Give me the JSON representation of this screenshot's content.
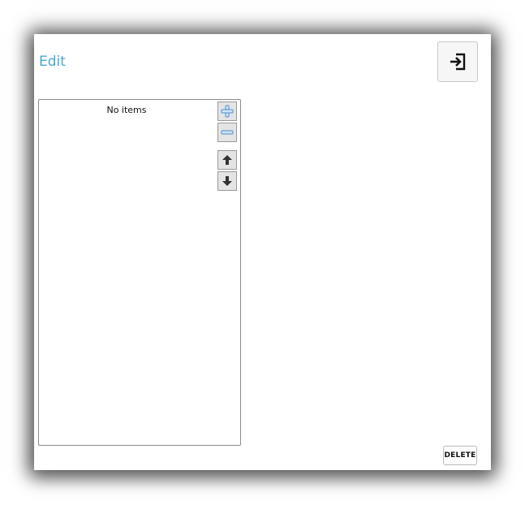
{
  "dialog": {
    "title": "Edit",
    "exit_icon": "sign-in-arrow-icon"
  },
  "list": {
    "empty_text": "No items",
    "controls": [
      {
        "name": "add",
        "icon": "plus-icon"
      },
      {
        "name": "remove",
        "icon": "minus-icon"
      },
      {
        "name": "move-up",
        "icon": "arrow-up-icon"
      },
      {
        "name": "move-down",
        "icon": "arrow-down-icon"
      }
    ]
  },
  "footer": {
    "delete_label": "DELETE"
  },
  "colors": {
    "title": "#4aa6d8",
    "plus_minus": "#5aa0d8",
    "arrow": "#333333"
  }
}
